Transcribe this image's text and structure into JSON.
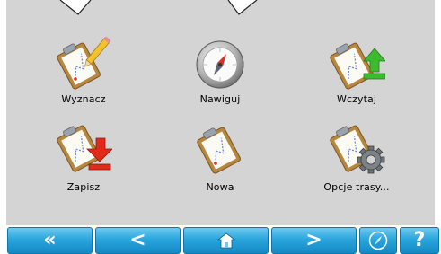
{
  "menu": {
    "tiles": [
      {
        "id": "route",
        "label": "Wyznacz",
        "icon": "clipboard-pencil-icon"
      },
      {
        "id": "navigate",
        "label": "Nawiguj",
        "icon": "compass-icon"
      },
      {
        "id": "load",
        "label": "Wczytaj",
        "icon": "clipboard-upload-icon"
      },
      {
        "id": "save",
        "label": "Zapisz",
        "icon": "clipboard-download-icon"
      },
      {
        "id": "new",
        "label": "Nowa",
        "icon": "clipboard-new-icon"
      },
      {
        "id": "options",
        "label": "Opcje trasy...",
        "icon": "clipboard-gear-icon"
      }
    ]
  },
  "toolbar": {
    "buttons": [
      {
        "id": "first",
        "glyph": "«",
        "icon": "double-chevron-left-icon"
      },
      {
        "id": "prev",
        "glyph": "<",
        "icon": "chevron-left-icon"
      },
      {
        "id": "home",
        "glyph": "",
        "icon": "home-icon"
      },
      {
        "id": "next",
        "glyph": ">",
        "icon": "chevron-right-icon"
      },
      {
        "id": "map",
        "glyph": "",
        "icon": "compass-icon"
      },
      {
        "id": "help",
        "glyph": "?",
        "icon": "help-icon"
      }
    ]
  },
  "colors": {
    "panel": "#d4d4d4",
    "toolbar_top": "#6fc8ef",
    "toolbar_bottom": "#1488c3",
    "arrow_green": "#3dbb2e",
    "arrow_red": "#e02a1a"
  }
}
